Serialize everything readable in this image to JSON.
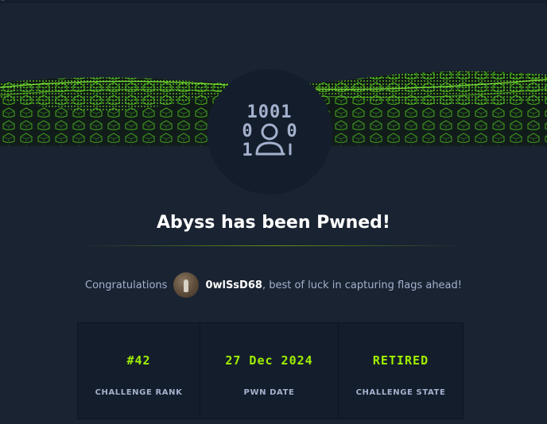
{
  "page": {
    "corner_glyph": "«"
  },
  "banner": {
    "badge_icon": "binary-user-icon",
    "badge_digits": {
      "top": "1001",
      "left": "0",
      "right": "0",
      "bottom": "1"
    }
  },
  "title": "Abyss has been Pwned!",
  "congrats": {
    "prefix": "Congratulations",
    "username": "0wlSsD68",
    "suffix": ", best of luck in capturing flags ahead!"
  },
  "stats": [
    {
      "value": "#42",
      "label": "CHALLENGE RANK"
    },
    {
      "value": "27 Dec 2024",
      "label": "PWN DATE"
    },
    {
      "value": "RETIRED",
      "label": "CHALLENGE STATE"
    }
  ],
  "colors": {
    "background": "#1a2332",
    "panel": "#141d2b",
    "accent": "#9fef00",
    "text": "#a4b1cd",
    "icon": "#a4b1cd"
  }
}
